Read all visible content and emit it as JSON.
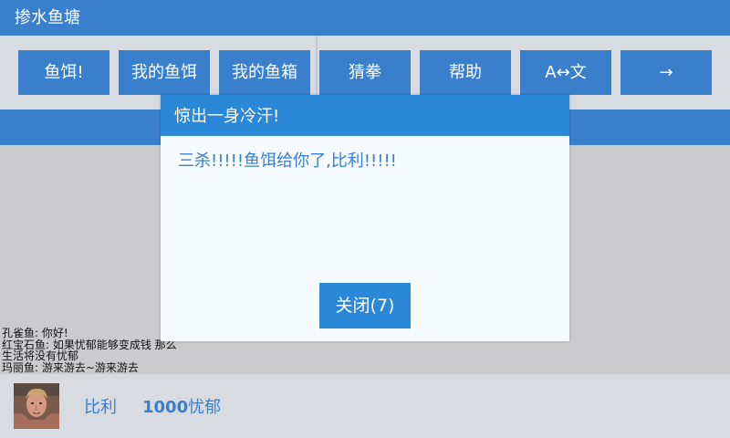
{
  "app": {
    "title": "掺水鱼塘"
  },
  "toolbar": {
    "buttons": [
      {
        "label": "鱼饵!"
      },
      {
        "label": "我的鱼饵"
      },
      {
        "label": "我的鱼箱"
      },
      {
        "label": "猜拳"
      },
      {
        "label": "帮助"
      },
      {
        "label": "A↔文"
      },
      {
        "label": "→"
      }
    ]
  },
  "chat": {
    "lines": [
      "孔雀鱼: 你好!",
      "红宝石鱼: 如果忧郁能够变成钱 那么",
      "生活将没有忧郁",
      "玛丽鱼: 游来游去~游来游去"
    ]
  },
  "player": {
    "name": "比利",
    "currency_amount": "1000",
    "currency_unit": "忧郁"
  },
  "dialog": {
    "title": "惊出一身冷汗!",
    "message": "三杀!!!!!鱼饵给你了,比利!!!!!",
    "close_label": "关闭(7)"
  },
  "colors": {
    "primary": "#3a7fcc",
    "dialog_accent": "#2b87d8",
    "toolbar_bg": "#d8dce1",
    "page_bg": "#cbcbcd"
  }
}
